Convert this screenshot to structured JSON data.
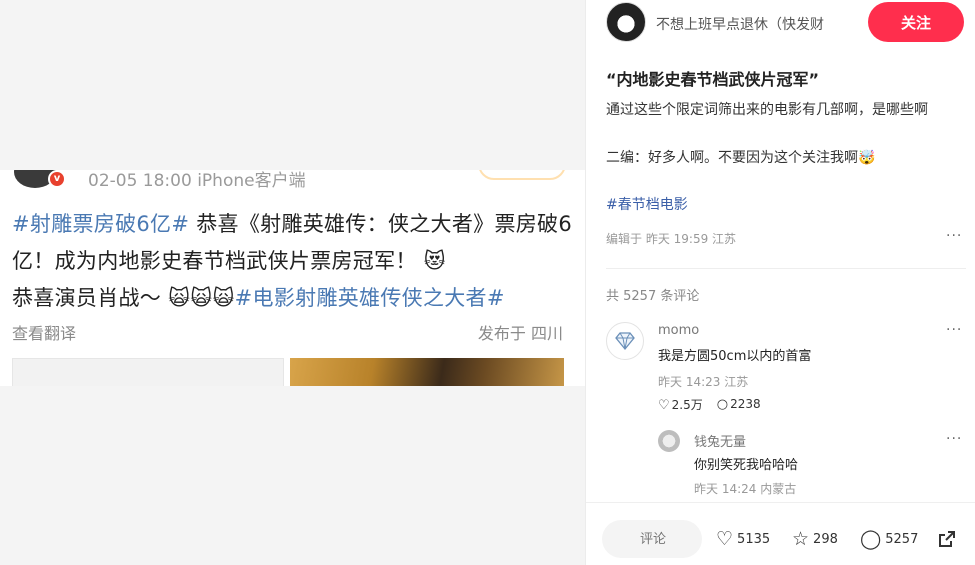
{
  "shot": {
    "meta": "02-05 18:00   iPhone客户端",
    "badge": "v",
    "text": {
      "tag1": "#射雕票房破6亿#",
      "body1": " 恭喜《射雕英雄传：侠之大者》票房破6亿！成为内地影史春节档武侠片票房冠军！",
      "emoji1": " 😻",
      "body2": "恭喜演员肖战～ ",
      "emojis": "🙀🙀🙀",
      "tag2": "#电影射雕英雄传侠之大者#"
    },
    "translate": "查看翻译",
    "from": "发布于 四川"
  },
  "author": {
    "name": "不想上班早点退休（快发财",
    "follow_label": "关注"
  },
  "post": {
    "title": "“内地影史春节档武侠片冠军”",
    "body_line1": "通过这些个限定词筛出来的电影有几部啊，是哪些啊",
    "body_line2": "二编：好多人啊。不要因为这个关注我啊🤯",
    "tag": "#春节档电影",
    "edit_info": "编辑于 昨天 19:59 江苏",
    "more": "···"
  },
  "comments": {
    "count_label": "共 5257 条评论",
    "items": [
      {
        "name": "momo",
        "text": "我是方圆50cm以内的首富",
        "meta": "昨天 14:23 江苏",
        "likes": "2.5万",
        "replies": "2238",
        "more": "···"
      }
    ],
    "reply": {
      "name": "钱兔无量",
      "text": "你别笑死我哈哈哈",
      "meta": "昨天 14:24 内蒙古",
      "more": "···"
    }
  },
  "bottom": {
    "comment_placeholder": "评论",
    "likes": "5135",
    "stars": "298",
    "comments": "5257"
  }
}
